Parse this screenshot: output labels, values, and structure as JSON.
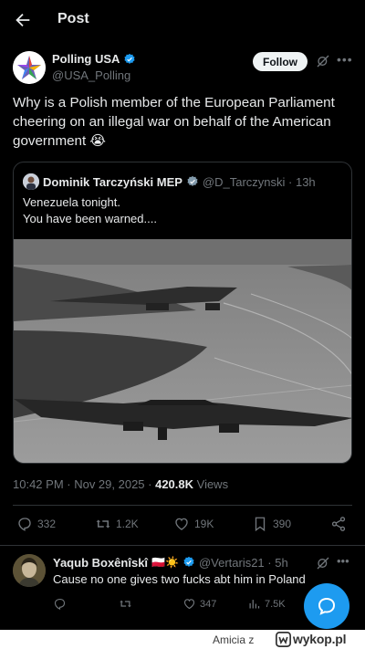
{
  "header": {
    "title": "Post"
  },
  "post": {
    "author_name": "Polling USA",
    "author_handle": "@USA_Polling",
    "follow_label": "Follow",
    "text": "Why is a Polish member of the European Parliament cheering on an illegal war on behalf of the American government 😭",
    "time": "10:42 PM · Nov 29, 2025 · ",
    "views_count": "420.8K",
    "views_label": " Views"
  },
  "quoted": {
    "author_name": "Dominik Tarczyński MEP",
    "author_handle": "@D_Tarczynski · 13h",
    "text": "Venezuela tonight.\nYou have been warned...."
  },
  "actions": {
    "replies": "332",
    "reposts": "1.2K",
    "likes": "19K",
    "bookmarks": "390"
  },
  "reply": {
    "author_name": "Yaqub Boxênîskî",
    "author_flags": "🇵🇱☀️",
    "author_handle": "@Vertaris21 · 5h",
    "text": "Cause no one gives two fucks abt him in Poland",
    "likes": "347",
    "views": "7.5K"
  },
  "footer": {
    "author": "Amicia  z",
    "site": "wykop.pl"
  },
  "colors": {
    "background": "#000000",
    "text_primary": "#e7e9ea",
    "text_secondary": "#71767b",
    "accent": "#1d9bf0",
    "border": "#2f3336"
  },
  "icons": [
    "back-arrow-icon",
    "verified-badge-icon",
    "grok-icon",
    "more-icon",
    "reply-icon",
    "repost-icon",
    "like-icon",
    "bookmark-icon",
    "share-icon",
    "views-icon",
    "chat-icon",
    "wykop-logo-icon"
  ]
}
